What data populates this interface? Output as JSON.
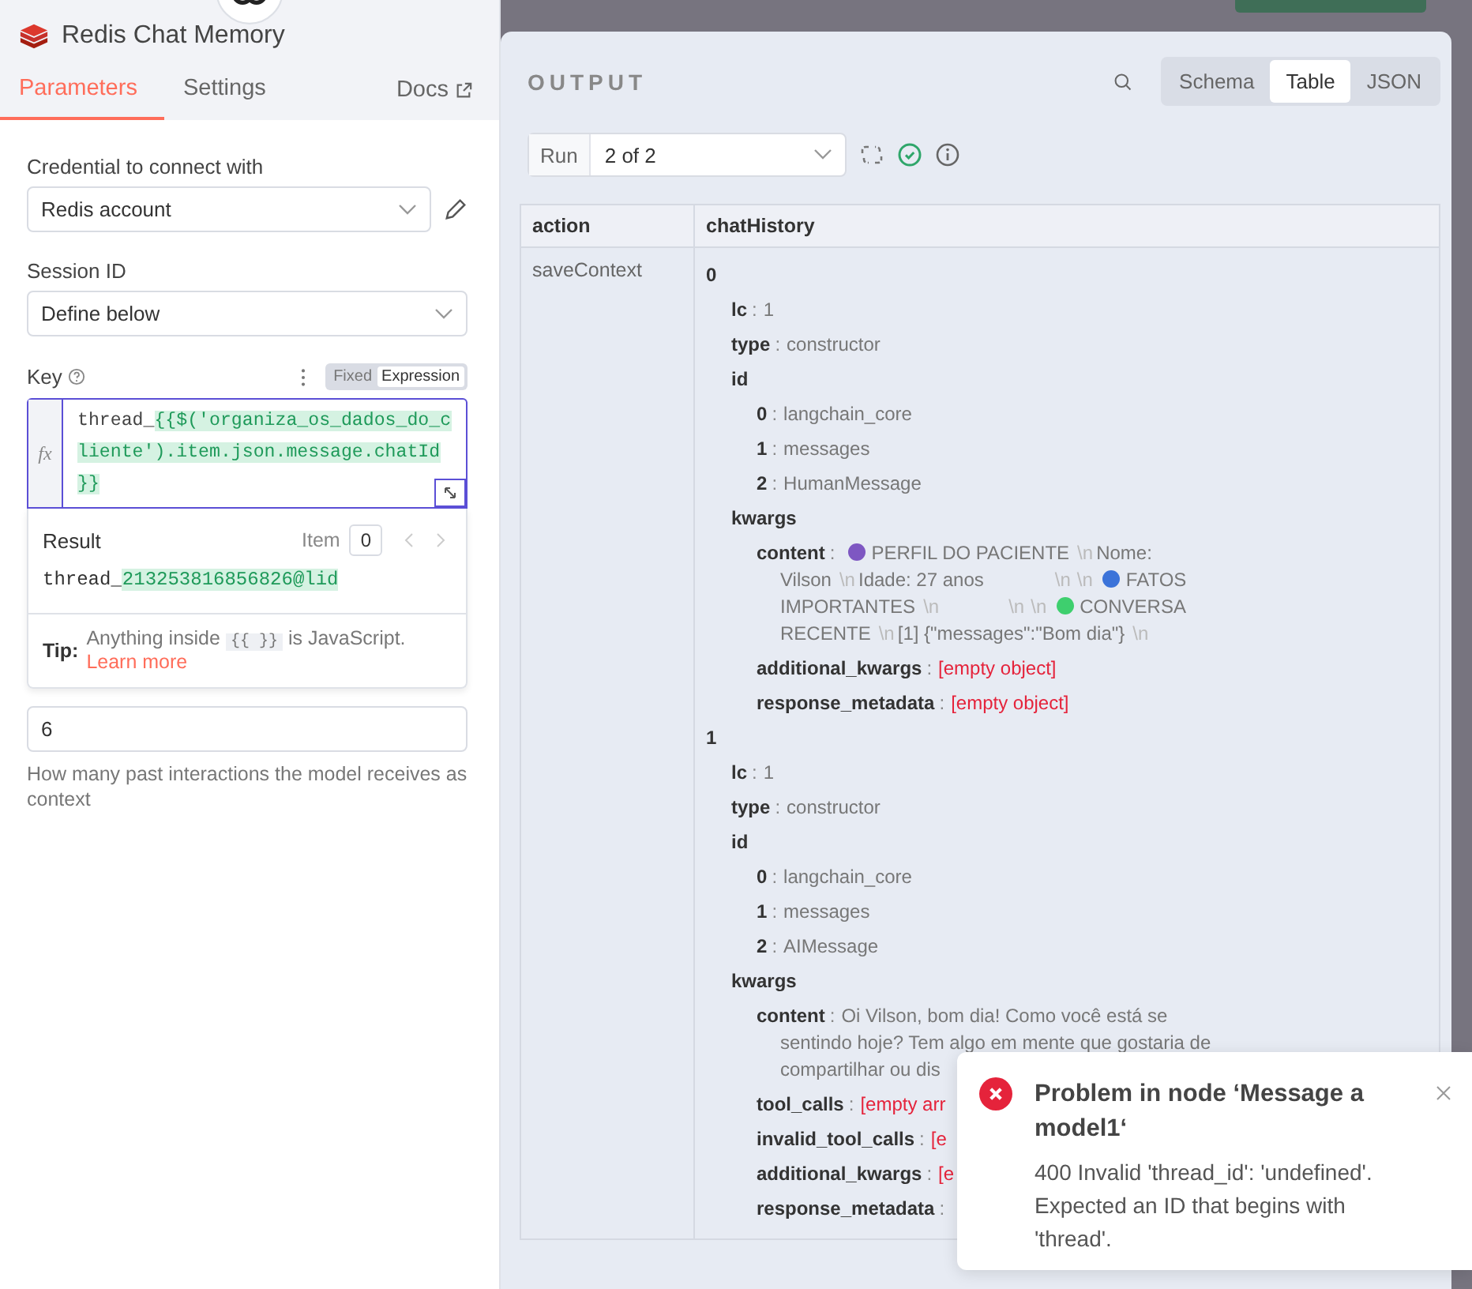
{
  "node": {
    "title": "Redis Chat Memory"
  },
  "tabs": [
    {
      "label": "Parameters",
      "selected": true
    },
    {
      "label": "Settings",
      "selected": false
    }
  ],
  "docs_link": "Docs",
  "credential": {
    "label": "Credential to connect with",
    "value": "Redis account"
  },
  "session": {
    "label": "Session ID",
    "value": "Define below"
  },
  "key": {
    "label": "Key",
    "modes": [
      {
        "label": "Fixed",
        "selected": false
      },
      {
        "label": "Expression",
        "selected": true
      }
    ],
    "gutter": "fx",
    "parts": [
      {
        "kind": "plain",
        "text": "thread_"
      },
      {
        "kind": "expr",
        "text": "{{$('organiza_os_dados_do_cliente').item.json.message.chatId }}"
      }
    ]
  },
  "result": {
    "label": "Result",
    "item_label": "Item",
    "item_value": "0",
    "parts": [
      {
        "kind": "plain",
        "text": "thread_"
      },
      {
        "kind": "expr",
        "text": "213253816856826@lid"
      }
    ]
  },
  "tip": {
    "label": "Tip:",
    "before": "Anything inside",
    "code": "{{ }}",
    "after": "is JavaScript.",
    "link": "Learn more"
  },
  "context_window": {
    "value": "6",
    "hint": "How many past interactions the model receives as context"
  },
  "output": {
    "title": "OUTPUT",
    "views": [
      {
        "label": "Schema",
        "selected": false
      },
      {
        "label": "Table",
        "selected": true
      },
      {
        "label": "JSON",
        "selected": false
      }
    ],
    "run_label": "Run",
    "run_value": "2 of 2",
    "columns": [
      "action",
      "chatHistory"
    ],
    "action": "saveContext",
    "key_separator": ":",
    "tree": [
      {
        "key": "0",
        "children": [
          {
            "key": "lc",
            "value": "1",
            "kind": "text"
          },
          {
            "key": "type",
            "value": "constructor",
            "kind": "text"
          },
          {
            "key": "id",
            "children": [
              {
                "key": "0",
                "value": "langchain_core",
                "kind": "text"
              },
              {
                "key": "1",
                "value": "messages",
                "kind": "text"
              },
              {
                "key": "2",
                "value": "HumanMessage",
                "kind": "text"
              }
            ]
          },
          {
            "key": "kwargs",
            "children": [
              {
                "key": "content",
                "lines": [
                  {
                    "segments": [
                      {
                        "kind": "dot",
                        "color": "#7e57c2"
                      },
                      {
                        "kind": "text",
                        "text": "PERFIL DO PACIENTE"
                      },
                      {
                        "kind": "newline",
                        "text": "\\n"
                      },
                      {
                        "kind": "text",
                        "text": "Nome:"
                      }
                    ]
                  },
                  {
                    "segments": [
                      {
                        "kind": "text",
                        "text": "Vilson"
                      },
                      {
                        "kind": "newline",
                        "text": "\\n"
                      },
                      {
                        "kind": "text",
                        "text": "Idade: 27 anos"
                      },
                      {
                        "kind": "gap"
                      },
                      {
                        "kind": "newline",
                        "text": "\\n"
                      },
                      {
                        "kind": "newline",
                        "text": "\\n"
                      },
                      {
                        "kind": "dot",
                        "color": "#3b73d9"
                      },
                      {
                        "kind": "text",
                        "text": "FATOS"
                      }
                    ]
                  },
                  {
                    "segments": [
                      {
                        "kind": "text",
                        "text": "IMPORTANTES"
                      },
                      {
                        "kind": "newline",
                        "text": "\\n"
                      },
                      {
                        "kind": "gap"
                      },
                      {
                        "kind": "newline",
                        "text": "\\n"
                      },
                      {
                        "kind": "newline",
                        "text": "\\n"
                      },
                      {
                        "kind": "dot",
                        "color": "#3ecf6e"
                      },
                      {
                        "kind": "text",
                        "text": "CONVERSA"
                      }
                    ]
                  },
                  {
                    "segments": [
                      {
                        "kind": "text",
                        "text": "RECENTE"
                      },
                      {
                        "kind": "newline",
                        "text": "\\n"
                      },
                      {
                        "kind": "text",
                        "text": "[1] {\"messages\":\"Bom dia\"}"
                      },
                      {
                        "kind": "newline",
                        "text": "\\n"
                      }
                    ]
                  }
                ]
              },
              {
                "key": "additional_kwargs",
                "value": "[empty object]",
                "kind": "empty"
              },
              {
                "key": "response_metadata",
                "value": "[empty object]",
                "kind": "empty"
              }
            ]
          }
        ]
      },
      {
        "key": "1",
        "children": [
          {
            "key": "lc",
            "value": "1",
            "kind": "text"
          },
          {
            "key": "type",
            "value": "constructor",
            "kind": "text"
          },
          {
            "key": "id",
            "children": [
              {
                "key": "0",
                "value": "langchain_core",
                "kind": "text"
              },
              {
                "key": "1",
                "value": "messages",
                "kind": "text"
              },
              {
                "key": "2",
                "value": "AIMessage",
                "kind": "text"
              }
            ]
          },
          {
            "key": "kwargs",
            "children": [
              {
                "key": "content",
                "lines": [
                  {
                    "segments": [
                      {
                        "kind": "text",
                        "text": "Oi Vilson, bom dia! Como você está se"
                      }
                    ]
                  },
                  {
                    "segments": [
                      {
                        "kind": "text",
                        "text": "sentindo hoje? Tem algo em mente que gostaria de"
                      }
                    ]
                  },
                  {
                    "segments": [
                      {
                        "kind": "text",
                        "text": "compartilhar ou dis"
                      }
                    ]
                  }
                ]
              },
              {
                "key": "tool_calls",
                "value": "[empty arr",
                "kind": "empty"
              },
              {
                "key": "invalid_tool_calls",
                "value": "[e",
                "kind": "empty"
              },
              {
                "key": "additional_kwargs",
                "value": "[e",
                "kind": "empty"
              },
              {
                "key": "response_metadata"
              }
            ]
          }
        ]
      }
    ]
  },
  "toast": {
    "title": "Problem in node ‘Message a model1‘",
    "message": "400 Invalid 'thread_id': 'undefined'. Expected an ID that begins with 'thread'."
  }
}
